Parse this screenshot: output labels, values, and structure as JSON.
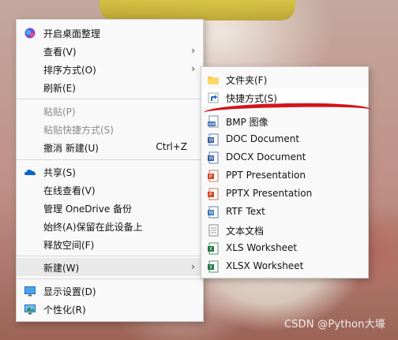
{
  "main_menu": {
    "items": [
      {
        "label": "开启桌面整理",
        "icon": "app-icon"
      },
      {
        "label": "查看(V)",
        "arrow": "›"
      },
      {
        "label": "排序方式(O)",
        "arrow": "›"
      },
      {
        "label": "刷新(E)"
      },
      {
        "label": "粘贴(P)",
        "disabled": true
      },
      {
        "label": "粘贴快捷方式(S)",
        "disabled": true
      },
      {
        "label": "撤消 新建(U)",
        "shortcut": "Ctrl+Z"
      },
      {
        "label": "共享(S)",
        "icon": "onedrive-icon"
      },
      {
        "label": "在线查看(V)"
      },
      {
        "label": "管理 OneDrive 备份"
      },
      {
        "label": "始终(A)保留在此设备上"
      },
      {
        "label": "释放空间(F)"
      },
      {
        "label": "新建(W)",
        "arrow": "›"
      },
      {
        "label": "显示设置(D)",
        "icon": "display-icon"
      },
      {
        "label": "个性化(R)",
        "icon": "personalize-icon"
      }
    ]
  },
  "sub_menu": {
    "items": [
      {
        "label": "文件夹(F)",
        "icon": "folder-icon"
      },
      {
        "label": "快捷方式(S)",
        "icon": "shortcut-icon"
      },
      {
        "label": "BMP 图像",
        "icon": "bmp-icon"
      },
      {
        "label": "DOC Document",
        "icon": "doc-icon"
      },
      {
        "label": "DOCX Document",
        "icon": "docx-icon"
      },
      {
        "label": "PPT Presentation",
        "icon": "ppt-icon"
      },
      {
        "label": "PPTX Presentation",
        "icon": "pptx-icon"
      },
      {
        "label": "RTF Text",
        "icon": "rtf-icon"
      },
      {
        "label": "文本文档",
        "icon": "txt-icon"
      },
      {
        "label": "XLS Worksheet",
        "icon": "xls-icon"
      },
      {
        "label": "XLSX Worksheet",
        "icon": "xlsx-icon"
      }
    ]
  },
  "watermark": "CSDN @Python大壕",
  "colors": {
    "highlight": "#e9e9e9",
    "red_mark": "#d4141a",
    "menu_bg": "#f9f9f9"
  }
}
